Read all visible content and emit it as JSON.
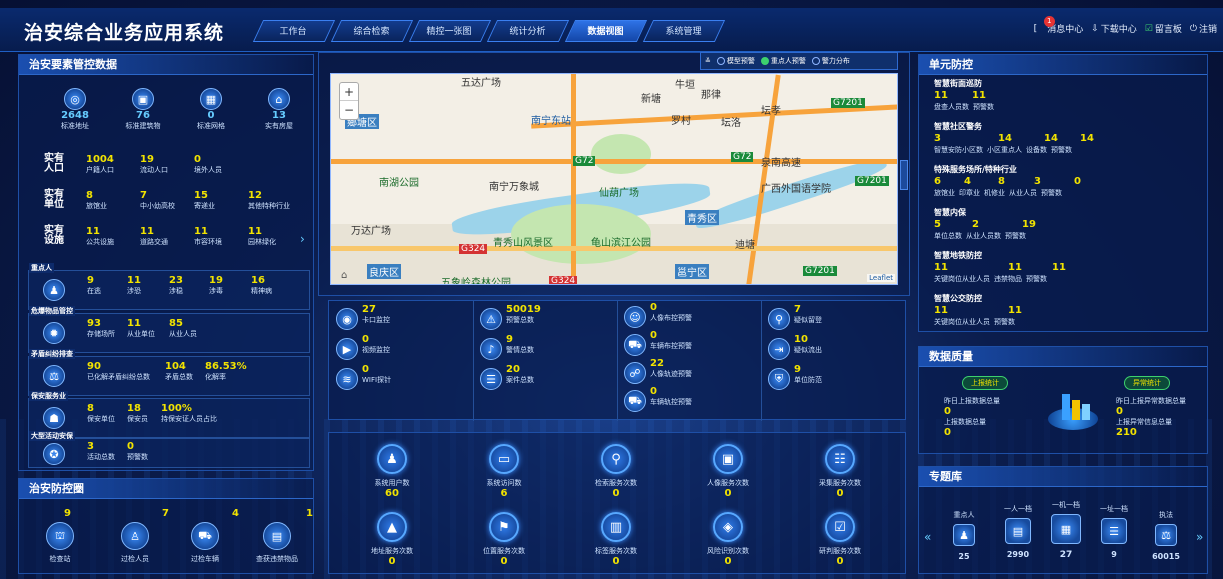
{
  "app": {
    "title": "治安综合业务应用系统"
  },
  "nav": {
    "tabs": [
      "工作台",
      "综合检索",
      "精控一张图",
      "统计分析",
      "数据视图",
      "系统管理"
    ],
    "active_index": 4
  },
  "topright": {
    "message_center": "消息中心",
    "message_badge": "1",
    "download_center": "下载中心",
    "message_board": "留言板",
    "logout": "注销"
  },
  "left": {
    "title": "治安要素管控数据",
    "icons": [
      {
        "value": "2648",
        "label": "标准地址",
        "icon": "location-icon"
      },
      {
        "value": "76",
        "label": "标准建筑物",
        "icon": "building-icon"
      },
      {
        "value": "0",
        "label": "标准网格",
        "icon": "grid-icon"
      },
      {
        "value": "13",
        "label": "实有房屋",
        "icon": "house-icon"
      }
    ],
    "population": {
      "head_top": "实有",
      "head_bottom": "人口",
      "items": [
        {
          "value": "1004",
          "label": "户籍人口"
        },
        {
          "value": "19",
          "label": "流动人口"
        },
        {
          "value": "0",
          "label": "境外人员"
        }
      ]
    },
    "units": {
      "head_top": "实有",
      "head_bottom": "单位",
      "items": [
        {
          "value": "8",
          "label": "旅馆业"
        },
        {
          "value": "7",
          "label": "中小幼高校"
        },
        {
          "value": "15",
          "label": "寄递业"
        },
        {
          "value": "12",
          "label": "其他特种行业"
        }
      ]
    },
    "facilities": {
      "head_top": "实有",
      "head_bottom": "设施",
      "items": [
        {
          "value": "11",
          "label": "公共设施"
        },
        {
          "value": "11",
          "label": "道路交通"
        },
        {
          "value": "11",
          "label": "市容环境"
        },
        {
          "value": "11",
          "label": "园林绿化"
        }
      ]
    },
    "key_persons": {
      "head": "重点人",
      "items": [
        {
          "value": "9",
          "label": "在逃"
        },
        {
          "value": "11",
          "label": "涉恐"
        },
        {
          "value": "23",
          "label": "涉稳"
        },
        {
          "value": "19",
          "label": "涉毒"
        },
        {
          "value": "16",
          "label": "精神病"
        }
      ]
    },
    "dangerous": {
      "head": "危爆物品管控",
      "items": [
        {
          "value": "93",
          "label": "存储场所"
        },
        {
          "value": "11",
          "label": "从业单位"
        },
        {
          "value": "85",
          "label": "从业人员"
        }
      ]
    },
    "disputes": {
      "head": "矛盾纠纷排查",
      "items": [
        {
          "value": "90",
          "label": "已化解矛盾纠纷总数"
        },
        {
          "value": "104",
          "label": "矛盾总数"
        },
        {
          "value": "86.53%",
          "label": "化解率"
        }
      ]
    },
    "security": {
      "head": "保安服务业",
      "items": [
        {
          "value": "8",
          "label": "保安单位"
        },
        {
          "value": "18",
          "label": "保安员"
        },
        {
          "value": "100%",
          "label": "持保安证人员占比"
        }
      ]
    },
    "events": {
      "head": "大型活动安保",
      "items": [
        {
          "value": "3",
          "label": "活动总数"
        },
        {
          "value": "0",
          "label": "预警数"
        }
      ]
    }
  },
  "checkpoint": {
    "title": "治安防控圈",
    "items": [
      {
        "value": "9",
        "label": "检查站"
      },
      {
        "value": "7",
        "label": "过检人员"
      },
      {
        "value": "4",
        "label": "过检车辆"
      },
      {
        "value": "1",
        "label": "查获违禁物品"
      }
    ]
  },
  "map": {
    "layers": [
      "模型预警",
      "重点人预警",
      "警力分布"
    ],
    "zoom_in": "+",
    "zoom_out": "−",
    "attribution": "Leaflet",
    "labels": [
      "五达广场",
      "南宁东站",
      "那律",
      "坛孝",
      "新塘",
      "罗村",
      "坛洛",
      "鄉塘区",
      "南宁万象城",
      "仙葫广场",
      "泉南高速",
      "南湖公园",
      "广西外国语学院",
      "万达广场",
      "青秀区",
      "青秀山风景区",
      "龟山滨江公园",
      "迪塘",
      "良庆区",
      "五象岭森林公园",
      "邕宁区",
      "牛垣"
    ],
    "road_tags": [
      "G7201",
      "G72",
      "G72",
      "G7201",
      "G324",
      "G324",
      "G7201"
    ]
  },
  "monitor": {
    "col1": [
      {
        "value": "27",
        "label": "卡口监控"
      },
      {
        "value": "0",
        "label": "视频监控"
      },
      {
        "value": "0",
        "label": "WIFI探针"
      }
    ],
    "col2": [
      {
        "value": "50019",
        "label": "预警总数"
      },
      {
        "value": "9",
        "label": "警情总数"
      },
      {
        "value": "20",
        "label": "案件总数"
      }
    ],
    "col3": [
      {
        "value": "0",
        "label": "人像布控预警"
      },
      {
        "value": "0",
        "label": "车辆布控预警"
      },
      {
        "value": "22",
        "label": "人像轨迹预警"
      },
      {
        "value": "0",
        "label": "车辆轨控预警"
      }
    ],
    "col4": [
      {
        "value": "7",
        "label": "疑似留登"
      },
      {
        "value": "10",
        "label": "疑似流出"
      },
      {
        "value": "9",
        "label": "单位防范"
      }
    ]
  },
  "services": [
    {
      "label": "系统用户数",
      "value": "60",
      "icon": "user-icon"
    },
    {
      "label": "系统访问数",
      "value": "6",
      "icon": "monitor-icon"
    },
    {
      "label": "检索服务次数",
      "value": "0",
      "icon": "search-icon"
    },
    {
      "label": "人像服务次数",
      "value": "0",
      "icon": "portrait-icon"
    },
    {
      "label": "采集服务次数",
      "value": "0",
      "icon": "collect-icon"
    },
    {
      "label": "地址服务次数",
      "value": "0",
      "icon": "address-icon"
    },
    {
      "label": "位置服务次数",
      "value": "0",
      "icon": "pin-icon"
    },
    {
      "label": "标签服务次数",
      "value": "0",
      "icon": "book-icon"
    },
    {
      "label": "风险识别次数",
      "value": "0",
      "icon": "tag-icon"
    },
    {
      "label": "研判服务次数",
      "value": "0",
      "icon": "analysis-icon"
    }
  ],
  "right": {
    "title": "单元防控",
    "sections": [
      {
        "head": "智慧街面巡防",
        "values": [
          "11",
          "11"
        ],
        "labels": [
          "盘查人员数",
          "预警数"
        ]
      },
      {
        "head": "智慧社区警务",
        "values": [
          "3",
          "14",
          "14",
          "14"
        ],
        "labels": [
          "智慧安防小区数",
          "小区重点人",
          "设备数",
          "预警数"
        ]
      },
      {
        "head": "特殊服务场所/特种行业",
        "values": [
          "6",
          "4",
          "8",
          "3",
          "0"
        ],
        "labels": [
          "旅馆业",
          "印章业",
          "机修业",
          "从业人员",
          "预警数"
        ]
      },
      {
        "head": "智慧内保",
        "values": [
          "5",
          "2",
          "19"
        ],
        "labels": [
          "单位总数",
          "从业人员数",
          "预警数"
        ]
      },
      {
        "head": "智慧地铁防控",
        "values": [
          "11",
          "11",
          "11"
        ],
        "labels": [
          "关键岗位从业人员",
          "违禁物品",
          "预警数"
        ]
      },
      {
        "head": "智慧公交防控",
        "values": [
          "11",
          "11"
        ],
        "labels": [
          "关键岗位从业人员",
          "预警数"
        ]
      }
    ]
  },
  "quality": {
    "title": "数据质量",
    "report_tag": "上报统计",
    "abnormal_tag": "异常统计",
    "left": [
      {
        "label": "昨日上报数据总量",
        "value": "0"
      },
      {
        "label": "上报数据总量",
        "value": "0"
      }
    ],
    "right": [
      {
        "label": "昨日上报异常数据总量",
        "value": "0"
      },
      {
        "label": "上报异常信息总量",
        "value": "210"
      }
    ]
  },
  "topics": {
    "title": "专题库",
    "items": [
      {
        "label": "重点人",
        "value": "25"
      },
      {
        "label": "一人一档",
        "value": "2990"
      },
      {
        "label": "一机一档",
        "value": "27"
      },
      {
        "label": "一址一档",
        "value": "9"
      },
      {
        "label": "执法",
        "value": "60015"
      }
    ]
  },
  "colors": {
    "accent": "#f2e300",
    "panel_border": "#1e4fa6",
    "background": "#0b1d4d"
  }
}
